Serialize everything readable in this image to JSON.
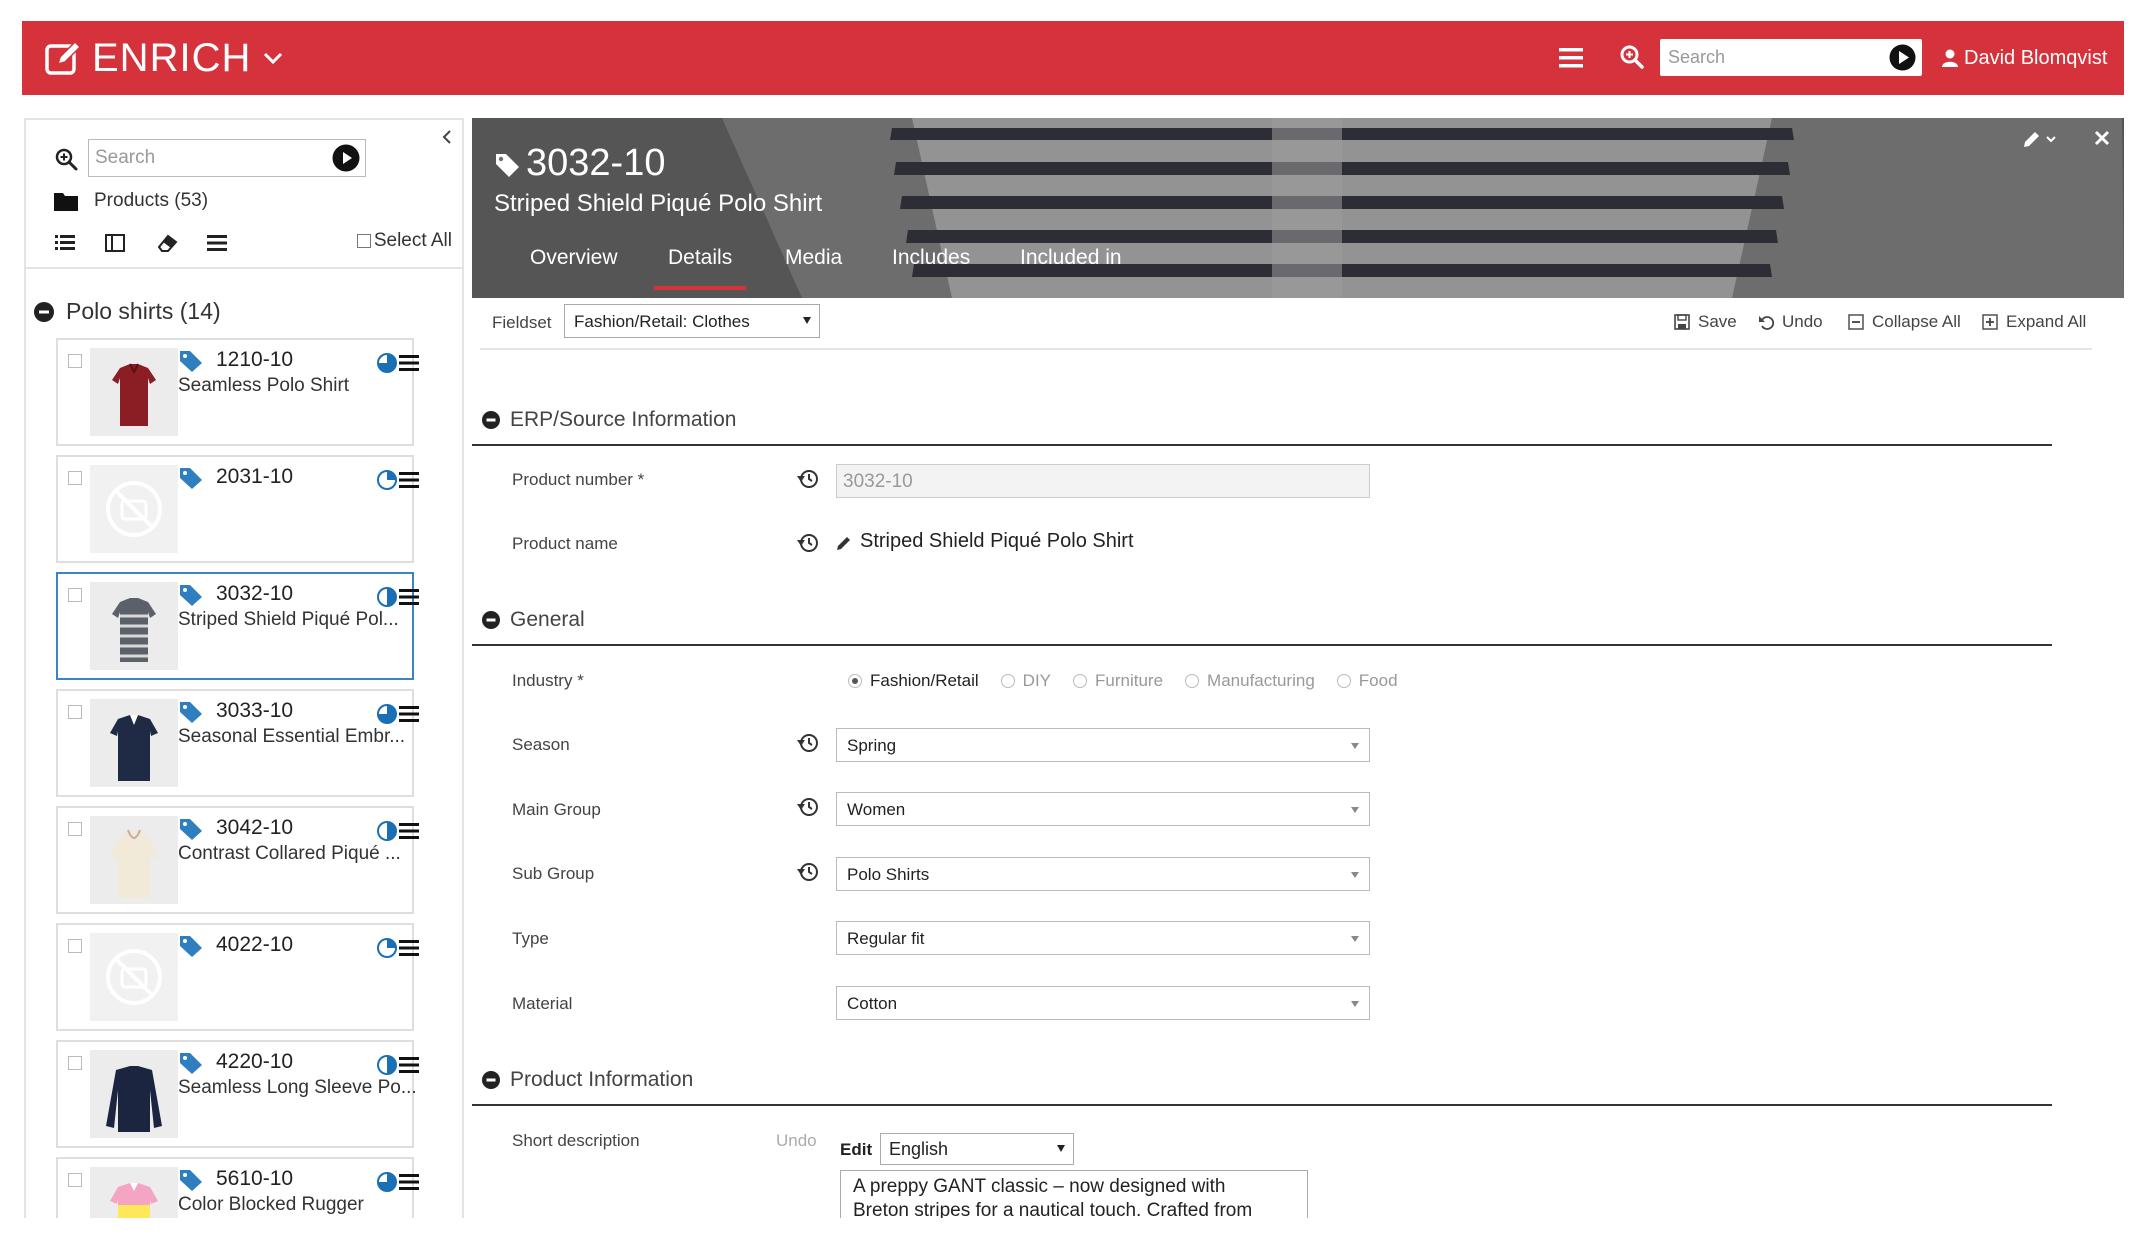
{
  "colors": {
    "brand_red": "#d5323c",
    "selected_border": "#3b83c8",
    "tag_blue": "#2f7fc0"
  },
  "topbar": {
    "app_name": "ENRICH",
    "search_placeholder": "Search",
    "user_name": "David Blomqvist",
    "icons": [
      "edit-icon",
      "chevron-down-icon",
      "hamburger-icon",
      "zoom-icon",
      "play-icon",
      "user-icon"
    ]
  },
  "sidebar": {
    "search_placeholder": "Search",
    "folder_label": "Products (53)",
    "select_all_label": "Select All",
    "view_icons": [
      "list-view-icon",
      "columns-view-icon",
      "eraser-icon",
      "menu-icon"
    ],
    "group_label": "Polo shirts (14)",
    "products": [
      {
        "number": "1210-10",
        "name": "Seamless Polo Shirt",
        "status": "three-quarter",
        "thumb": "red-polo"
      },
      {
        "number": "2031-10",
        "name": "",
        "status": "quarter",
        "thumb": "no-image"
      },
      {
        "number": "3032-10",
        "name": "Striped Shield Piqué Pol...",
        "status": "half",
        "thumb": "striped-polo",
        "selected": true
      },
      {
        "number": "3033-10",
        "name": "Seasonal Essential Embr...",
        "status": "three-quarter",
        "thumb": "navy-polo"
      },
      {
        "number": "3042-10",
        "name": "Contrast Collared Piqué ...",
        "status": "half",
        "thumb": "cream-hoodie"
      },
      {
        "number": "4022-10",
        "name": "",
        "status": "quarter",
        "thumb": "no-image"
      },
      {
        "number": "4220-10",
        "name": "Seamless Long Sleeve Po...",
        "status": "half",
        "thumb": "navy-longsleeve"
      },
      {
        "number": "5610-10",
        "name": "Color Blocked Rugger",
        "status": "three-quarter",
        "thumb": "pink-rugger"
      }
    ]
  },
  "detail": {
    "number": "3032-10",
    "name": "Striped Shield Piqué Polo Shirt",
    "tabs": [
      "Overview",
      "Details",
      "Media",
      "Includes",
      "Included in"
    ],
    "active_tab": "Details",
    "fieldset_label": "Fieldset",
    "fieldset_value": "Fashion/Retail: Clothes",
    "actions": {
      "save": "Save",
      "undo": "Undo",
      "collapse_all": "Collapse All",
      "expand_all": "Expand All"
    },
    "sections": {
      "erp": "ERP/Source Information",
      "general": "General",
      "product_info": "Product Information"
    },
    "fields": {
      "product_number_label": "Product number *",
      "product_number_value": "3032-10",
      "product_name_label": "Product name",
      "product_name_value": "Striped Shield Piqué Polo Shirt",
      "industry_label": "Industry *",
      "industry_options": [
        "Fashion/Retail",
        "DIY",
        "Furniture",
        "Manufacturing",
        "Food"
      ],
      "industry_selected": "Fashion/Retail",
      "season_label": "Season",
      "season_value": "Spring",
      "main_group_label": "Main Group",
      "main_group_value": "Women",
      "sub_group_label": "Sub Group",
      "sub_group_value": "Polo Shirts",
      "type_label": "Type",
      "type_value": "Regular fit",
      "material_label": "Material",
      "material_value": "Cotton",
      "short_desc_label": "Short description",
      "short_desc_undo": "Undo",
      "short_desc_edit": "Edit",
      "short_desc_language": "English",
      "short_desc_text_line1": "A preppy GANT classic – now designed with",
      "short_desc_text_line2": "Breton stripes for a nautical touch. Crafted from"
    }
  }
}
